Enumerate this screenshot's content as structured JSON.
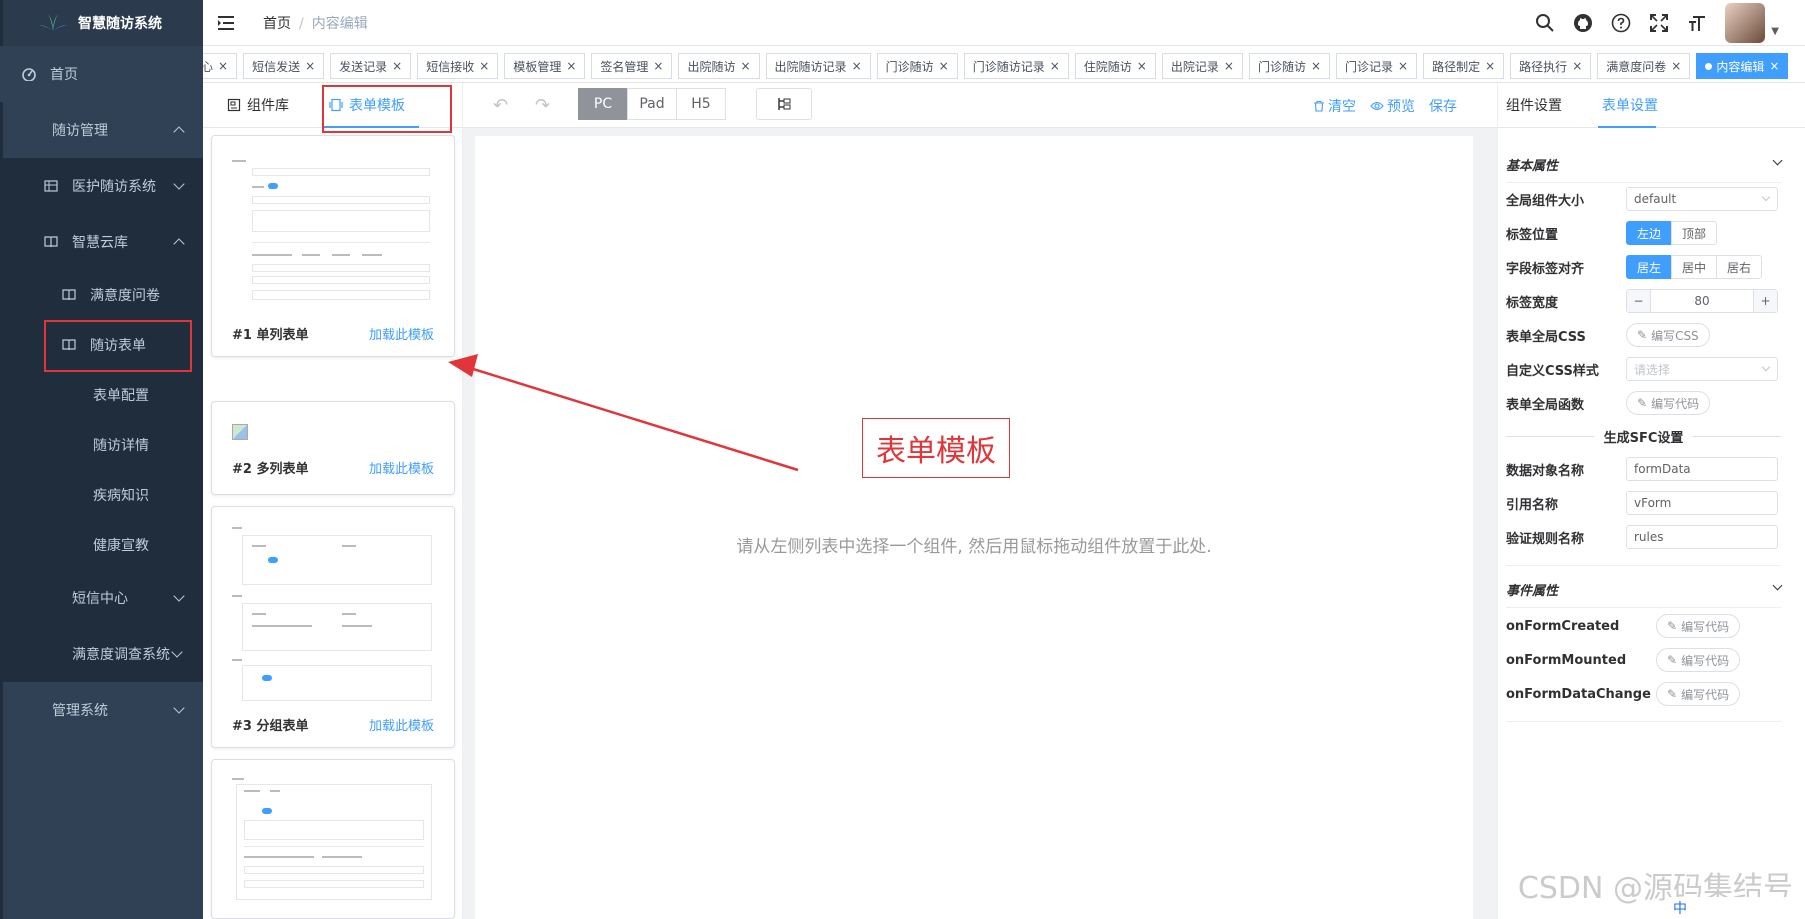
{
  "app": {
    "title": "智慧随访系统"
  },
  "sidebar": {
    "home": "首页",
    "followup_mgmt": "随访管理",
    "nursing_system": "医护随访系统",
    "cloud": "智慧云库",
    "satisfaction": "满意度问卷",
    "followup_form": "随访表单",
    "form_config": "表单配置",
    "followup_detail": "随访详情",
    "disease_knowledge": "疾病知识",
    "health_edu": "健康宣教",
    "sms_center": "短信中心",
    "survey_system": "满意度调查系统",
    "admin_system": "管理系统"
  },
  "header": {
    "breadcrumb_home": "首页",
    "breadcrumb_sep": "/",
    "breadcrumb_current": "内容编辑"
  },
  "tags": [
    "心",
    "短信发送",
    "发送记录",
    "短信接收",
    "模板管理",
    "签名管理",
    "出院随访",
    "出院随访记录",
    "门诊随访",
    "门诊随访记录",
    "住院随访",
    "出院记录",
    "门诊随访",
    "门诊记录",
    "路径制定",
    "路径执行",
    "满意度问卷",
    "内容编辑"
  ],
  "left_panel": {
    "tab_components": "组件库",
    "tab_templates": "表单模板",
    "templates": [
      {
        "name": "#1 单列表单",
        "load": "加载此模板"
      },
      {
        "name": "#2 多列表单",
        "load": "加载此模板"
      },
      {
        "name": "#3 分组表单",
        "load": "加载此模板"
      }
    ]
  },
  "toolbar": {
    "devices": [
      "PC",
      "Pad",
      "H5"
    ],
    "active_device": "PC",
    "clear": "清空",
    "preview": "预览",
    "save": "保存"
  },
  "canvas": {
    "hint": "请从左侧列表中选择一个组件, 然后用鼠标拖动组件放置于此处."
  },
  "annotation": {
    "label": "表单模板"
  },
  "right_panel": {
    "tab_component": "组件设置",
    "tab_form": "表单设置",
    "basic_section": "基本属性",
    "size_label": "全局组件大小",
    "size_value": "default",
    "label_pos_label": "标签位置",
    "label_pos_options": [
      "左边",
      "顶部"
    ],
    "align_label": "字段标签对齐",
    "align_options": [
      "居左",
      "居中",
      "居右"
    ],
    "width_label": "标签宽度",
    "width_value": "80",
    "css_label": "表单全局CSS",
    "css_btn": "编写CSS",
    "custom_css_label": "自定义CSS样式",
    "custom_css_placeholder": "请选择",
    "func_label": "表单全局函数",
    "code_btn": "编写代码",
    "sfc_title": "生成SFC设置",
    "data_obj_label": "数据对象名称",
    "data_obj_value": "formData",
    "ref_label": "引用名称",
    "ref_value": "vForm",
    "rules_label": "验证规则名称",
    "rules_value": "rules",
    "event_section": "事件属性",
    "events": [
      "onFormCreated",
      "onFormMounted",
      "onFormDataChange"
    ]
  },
  "watermark": "CSDN @源码集结号",
  "ime": "中"
}
